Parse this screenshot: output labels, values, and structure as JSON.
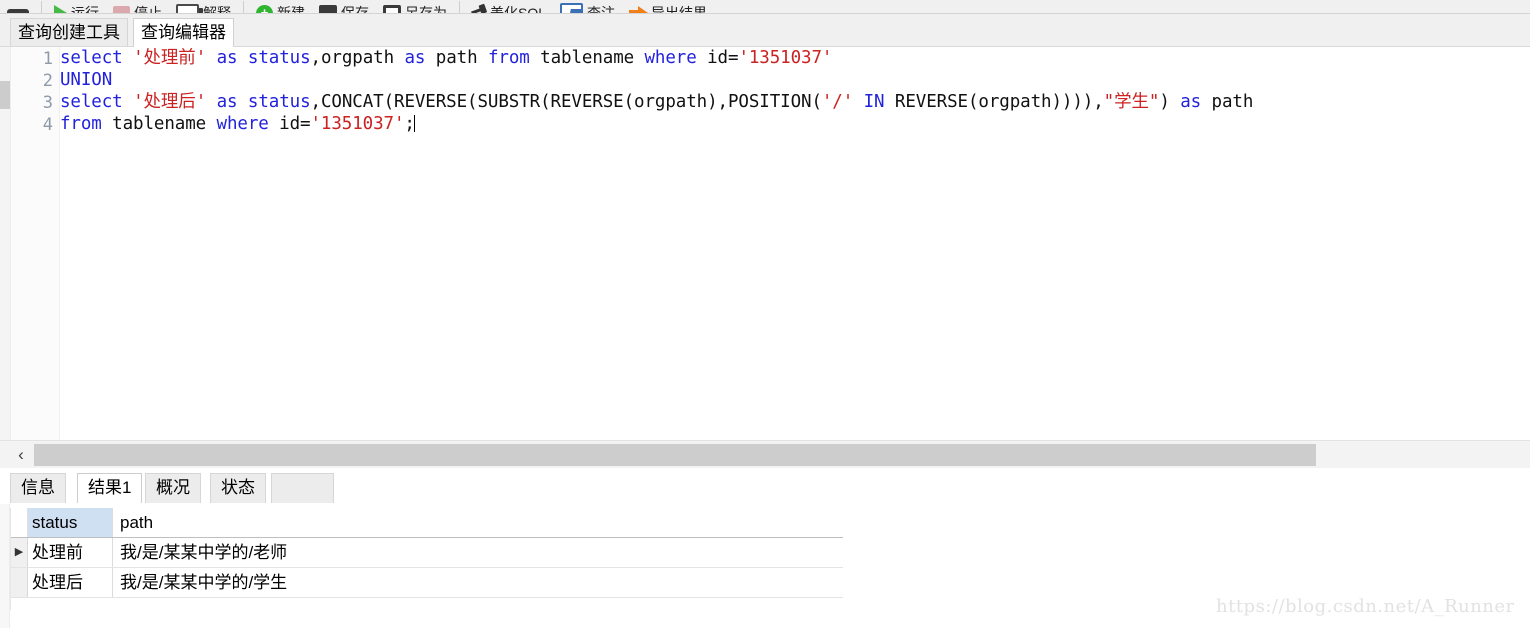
{
  "toolbar": {
    "items": [
      {
        "icon": "panel-handle-icon",
        "label": ""
      },
      {
        "icon": "run-icon",
        "label": "运行"
      },
      {
        "icon": "stop-icon",
        "label": "停止"
      },
      {
        "icon": "explain-icon",
        "label": "解释"
      },
      {
        "icon": "new-icon",
        "label": "新建"
      },
      {
        "icon": "save-icon",
        "label": "保存"
      },
      {
        "icon": "save-as-icon",
        "label": "另存为"
      },
      {
        "icon": "beautify-sql-icon",
        "label": "美化SQL"
      },
      {
        "icon": "export-icon",
        "label": "查注"
      },
      {
        "icon": "dump-result-icon",
        "label": "导出结果"
      }
    ]
  },
  "editor_tabs": [
    {
      "label": "查询创建工具",
      "active": false
    },
    {
      "label": "查询编辑器",
      "active": true
    }
  ],
  "editor": {
    "line_numbers": [
      "1",
      "2",
      "3",
      "4"
    ],
    "lines": [
      [
        {
          "t": "select ",
          "c": "kw"
        },
        {
          "t": "'处理前'",
          "c": "str"
        },
        {
          "t": " ",
          "c": "pl"
        },
        {
          "t": "as",
          "c": "kw"
        },
        {
          "t": " ",
          "c": "pl"
        },
        {
          "t": "status",
          "c": "kw"
        },
        {
          "t": ",orgpath ",
          "c": "pl"
        },
        {
          "t": "as",
          "c": "kw"
        },
        {
          "t": " path ",
          "c": "pl"
        },
        {
          "t": "from",
          "c": "kw"
        },
        {
          "t": " tablename ",
          "c": "pl"
        },
        {
          "t": "where",
          "c": "kw"
        },
        {
          "t": " id=",
          "c": "pl"
        },
        {
          "t": "'1351037'",
          "c": "str"
        }
      ],
      [
        {
          "t": "UNION",
          "c": "kw"
        }
      ],
      [
        {
          "t": "select ",
          "c": "kw"
        },
        {
          "t": "'处理后'",
          "c": "str"
        },
        {
          "t": " ",
          "c": "pl"
        },
        {
          "t": "as",
          "c": "kw"
        },
        {
          "t": " ",
          "c": "pl"
        },
        {
          "t": "status",
          "c": "kw"
        },
        {
          "t": ",CONCAT(REVERSE(SUBSTR(REVERSE(orgpath),POSITION(",
          "c": "pl"
        },
        {
          "t": "'/'",
          "c": "str"
        },
        {
          "t": " ",
          "c": "pl"
        },
        {
          "t": "IN",
          "c": "kw"
        },
        {
          "t": " REVERSE(orgpath)))),",
          "c": "pl"
        },
        {
          "t": "\"学生\"",
          "c": "str"
        },
        {
          "t": ") ",
          "c": "pl"
        },
        {
          "t": "as",
          "c": "kw"
        },
        {
          "t": " path",
          "c": "pl"
        }
      ],
      [
        {
          "t": "from",
          "c": "kw"
        },
        {
          "t": " tablename ",
          "c": "pl"
        },
        {
          "t": "where",
          "c": "kw"
        },
        {
          "t": " id=",
          "c": "pl"
        },
        {
          "t": "'1351037'",
          "c": "str"
        },
        {
          "t": ";",
          "c": "pl"
        }
      ]
    ]
  },
  "hscroll": {
    "left_arrow": "‹"
  },
  "result_tabs": [
    {
      "label": "信息",
      "active": false
    },
    {
      "label": "结果1",
      "active": true
    },
    {
      "label": "概况",
      "active": false
    },
    {
      "label": "状态",
      "active": false
    }
  ],
  "grid": {
    "headers": [
      "status",
      "path"
    ],
    "row_indicator": "▶",
    "rows": [
      {
        "indicator": "▶",
        "status": "处理前",
        "path": "我/是/某某中学的/老师"
      },
      {
        "indicator": "",
        "status": "处理后",
        "path": "我/是/某某中学的/学生"
      }
    ]
  },
  "watermark": {
    "text": "https://blog.csdn.net/A_Runner"
  },
  "colors": {
    "keyword": "#2222dd",
    "string": "#cc2222",
    "selected_column_header": "#cfe0f2",
    "run_icon": "#46b946",
    "new_icon": "#2fb52f",
    "arrow_icon": "#f07f17"
  }
}
